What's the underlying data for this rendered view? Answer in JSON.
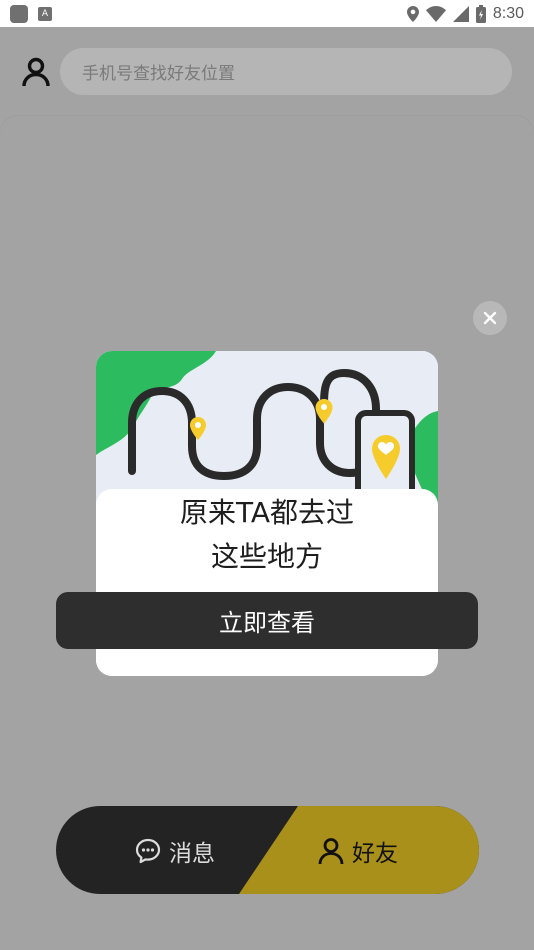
{
  "status_bar": {
    "time": "8:30",
    "notification_letter": "A"
  },
  "search": {
    "placeholder": "手机号查找好友位置"
  },
  "popup": {
    "title_line1": "原来TA都去过",
    "title_line2": "这些地方",
    "cta_label": "立即查看",
    "colors": {
      "green": "#2dbb5f",
      "pin": "#f6cc2c",
      "sky": "#e8edf5"
    }
  },
  "tabbar": {
    "tabs": [
      {
        "label": "消息",
        "icon": "chat-bubble-icon",
        "active": false
      },
      {
        "label": "好友",
        "icon": "person-icon",
        "active": true
      }
    ],
    "colors": {
      "inactive_bg": "#232323",
      "active_bg": "#a9901a"
    }
  }
}
